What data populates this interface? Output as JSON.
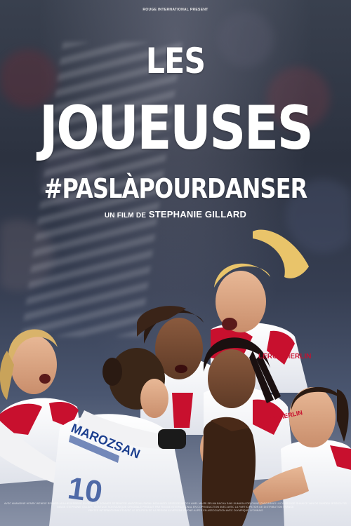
{
  "poster": {
    "presents": "ROUGE INTERNATIONAL PRESENT",
    "title_line1": "LES",
    "title_line2": "JOUEUSES",
    "title_line3": "#PASLÀPOURDANSER",
    "byline_prefix": "UN FILM DE",
    "director": "STEPHANIE GILLARD"
  },
  "jerseys": {
    "sponsor": "LEROY MERLIN",
    "back_name": "MAROZSAN",
    "back_number": "10"
  },
  "colors": {
    "jersey_white": "#f4f4f6",
    "jersey_red": "#c8102e",
    "jersey_blue": "#1c3f8f",
    "background_dark": "#2c3240"
  },
  "credits": {
    "line1": "AVEC AMANDINE HENRY  WENDIE RENARD  ADA HEGERBERG  EUGENIE LE SOMMER  DZSENIFER MAROZSAN  SARAH BOUHADDI  GRIEDGE MBOCK  AMEL MAJRI  SELMA BACHA  SAKI KUMAGAI  DELPHINE CASCARINO  LUCY BRONZE  SHANICE VAN DE SANDEN  JESSICA FISHLOCK  KADEISHA BUCHANAN",
    "line2": "IMAGE STEPHANIE GILLARD  MONTAGE  SON  MUSIQUE ORIGINALE  PRODUIT PAR ROUGE INTERNATIONAL  EN COPRODUCTION AVEC  AVEC LA PARTICIPATION DE  DISTRIBUTION FRANCE",
    "line3": "VENTES INTERNATIONALES  AVEC LE SOUTIEN DE LA REGION AUVERGNE-RHONE-ALPES  EN ASSOCIATION AVEC  OLYMPIQUE LYONNAIS"
  }
}
